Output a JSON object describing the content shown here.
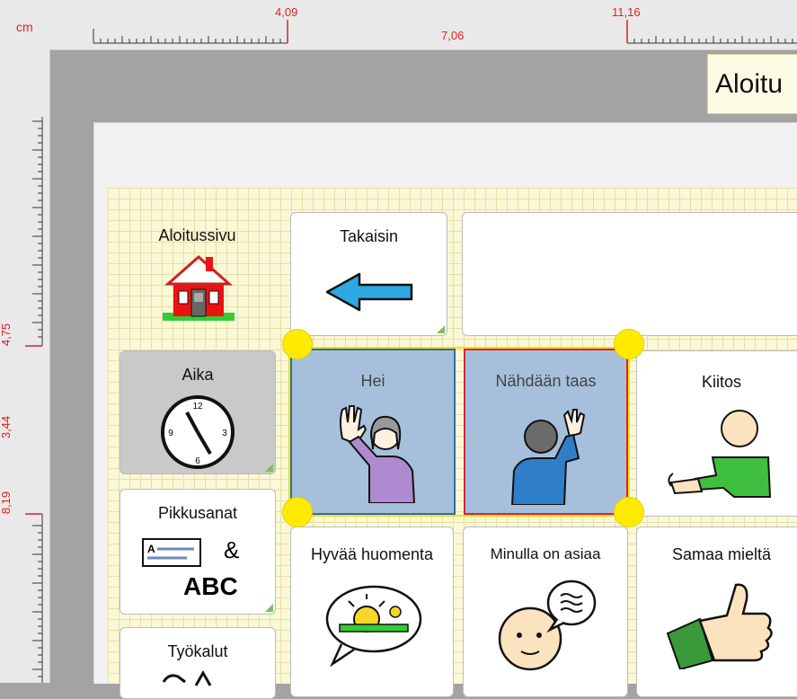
{
  "ruler": {
    "unit": "cm",
    "top_marks": [
      "4,09",
      "7,06",
      "11,16"
    ],
    "left_marks": [
      "4,75",
      "3,44",
      "8,19"
    ]
  },
  "tooltip": {
    "text": "Aloitu"
  },
  "cells": {
    "aloitussivu": "Aloitussivu",
    "takaisin": "Takaisin",
    "aika": "Aika",
    "hei": "Hei",
    "nahdaan": "Nähdään taas",
    "kiitos": "Kiitos",
    "pikkusanat": "Pikkusanat",
    "hyvaa": "Hyvää huomenta",
    "minulla": "Minulla on asiaa",
    "samaa": "Samaa mieltä",
    "tyokalut": "Työkalut"
  },
  "pictograms": {
    "abc_label": "ABC",
    "ampersand": "&"
  },
  "colors": {
    "ruler_accent": "#e02020",
    "selection": "#a6c0dc",
    "handle": "#ffeb00",
    "grid_bg": "#fbf8d6",
    "aika_bg": "#c9c9c9"
  }
}
